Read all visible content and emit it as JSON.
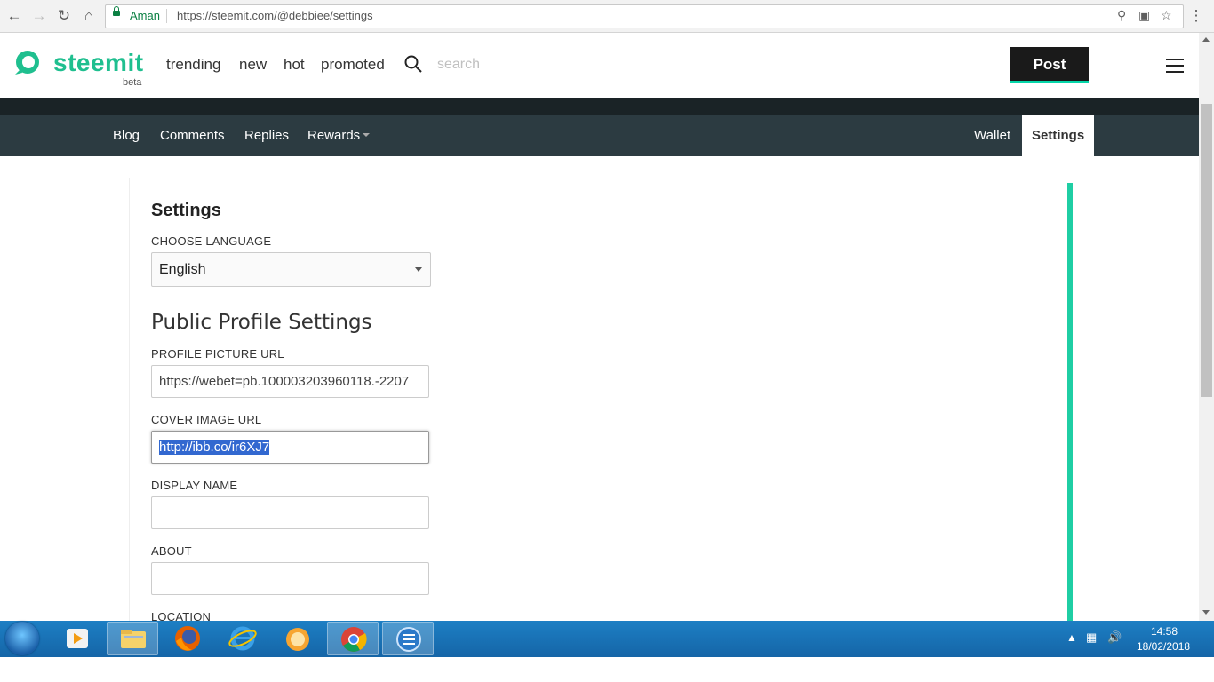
{
  "browser": {
    "site_identity": "Aman",
    "url": "https://steemit.com/@debbiee/settings"
  },
  "header": {
    "logo_text": "steemit",
    "logo_badge": "beta",
    "nav": [
      "trending",
      "new",
      "hot",
      "promoted"
    ],
    "search_placeholder": "search",
    "post_label": "Post"
  },
  "profile_tabs": {
    "left": [
      "Blog",
      "Comments",
      "Replies",
      "Rewards"
    ],
    "right": [
      "Wallet",
      "Settings"
    ]
  },
  "settings": {
    "title": "Settings",
    "language_label": "CHOOSE LANGUAGE",
    "language_value": "English",
    "public_title": "Public Profile Settings",
    "profile_picture_label": "PROFILE PICTURE URL",
    "profile_picture_value": "https://webet=pb.100003203960118.-2207",
    "cover_image_label": "COVER IMAGE URL",
    "cover_image_value": "http://ibb.co/ir6XJ7",
    "display_name_label": "DISPLAY NAME",
    "display_name_value": "",
    "about_label": "ABOUT",
    "about_value": "",
    "location_label": "LOCATION"
  },
  "taskbar": {
    "time": "14:58",
    "date": "18/02/2018"
  },
  "colors": {
    "brand_green": "#1fbf8f",
    "accent_teal": "#1fcea4",
    "tabbar": "#2c3b41",
    "selection": "#3268d0"
  }
}
